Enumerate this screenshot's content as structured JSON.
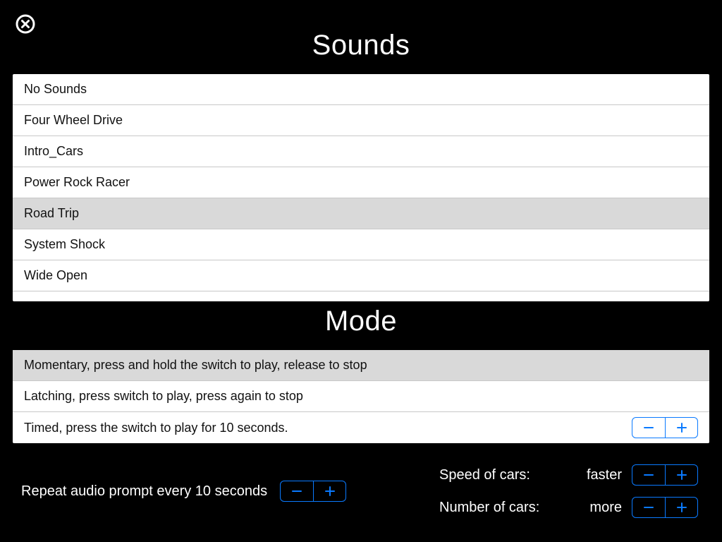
{
  "titles": {
    "sounds": "Sounds",
    "mode": "Mode"
  },
  "sounds": {
    "items": [
      {
        "label": "No Sounds",
        "selected": false
      },
      {
        "label": "Four Wheel Drive",
        "selected": false
      },
      {
        "label": "Intro_Cars",
        "selected": false
      },
      {
        "label": "Power Rock Racer",
        "selected": false
      },
      {
        "label": "Road Trip",
        "selected": true
      },
      {
        "label": "System Shock",
        "selected": false
      },
      {
        "label": "Wide Open",
        "selected": false
      }
    ]
  },
  "mode": {
    "items": [
      {
        "label": "Momentary, press and hold the switch to play, release to stop",
        "selected": true,
        "has_stepper": false
      },
      {
        "label": "Latching, press switch to play, press again to stop",
        "selected": false,
        "has_stepper": false
      },
      {
        "label": "Timed, press the switch to play for 10 seconds.",
        "selected": false,
        "has_stepper": true
      }
    ]
  },
  "bottom": {
    "repeat_label": "Repeat audio prompt every 10 seconds",
    "speed_label": "Speed of cars:",
    "speed_value": "faster",
    "number_label": "Number of cars:",
    "number_value": "more"
  },
  "colors": {
    "accent": "#0a7aff"
  }
}
